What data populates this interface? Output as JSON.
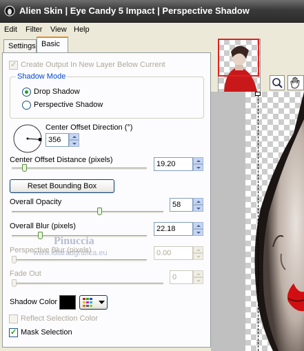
{
  "window": {
    "title": "Alien Skin | Eye Candy 5 Impact | Perspective Shadow"
  },
  "menu": [
    "Edit",
    "Filter",
    "View",
    "Help"
  ],
  "tabs": [
    {
      "label": "Settings"
    },
    {
      "label": "Basic"
    }
  ],
  "create_output": {
    "label": "Create Output In New Layer Below Current",
    "checked": true,
    "enabled": false
  },
  "shadow_mode": {
    "label": "Shadow Mode",
    "options": [
      {
        "label": "Drop Shadow",
        "selected": true
      },
      {
        "label": "Perspective Shadow",
        "selected": false
      }
    ]
  },
  "center_offset_direction": {
    "label": "Center Offset Direction (°)",
    "value": "356"
  },
  "center_offset_distance": {
    "label": "Center Offset Distance (pixels)",
    "value": "19.20",
    "slider_fraction": 0.08
  },
  "reset_button": {
    "label": "Reset Bounding Box"
  },
  "overall_opacity": {
    "label": "Overall Opacity",
    "value": "58",
    "slider_fraction": 0.58
  },
  "overall_blur": {
    "label": "Overall Blur (pixels)",
    "value": "22.18",
    "slider_fraction": 0.2
  },
  "perspective_blur": {
    "label": "Perspective Blur (pixels)",
    "value": "0.00",
    "slider_fraction": 0.0,
    "enabled": false
  },
  "fade_out": {
    "label": "Fade Out",
    "value": "0",
    "slider_fraction": 0.0,
    "enabled": false
  },
  "shadow_color": {
    "label": "Shadow Color",
    "color": "#000000"
  },
  "reflect_selection_color": {
    "label": "Reflect Selection Color",
    "checked": false,
    "enabled": false
  },
  "mask_selection": {
    "label": "Mask Selection",
    "checked": true
  },
  "watermark": {
    "line1": "Pinuccia",
    "line2": "www.idiaradgrafica.eu"
  },
  "colors": {
    "accent": "#e68b2c",
    "check": "#21a121",
    "lips": "#d10f12"
  }
}
